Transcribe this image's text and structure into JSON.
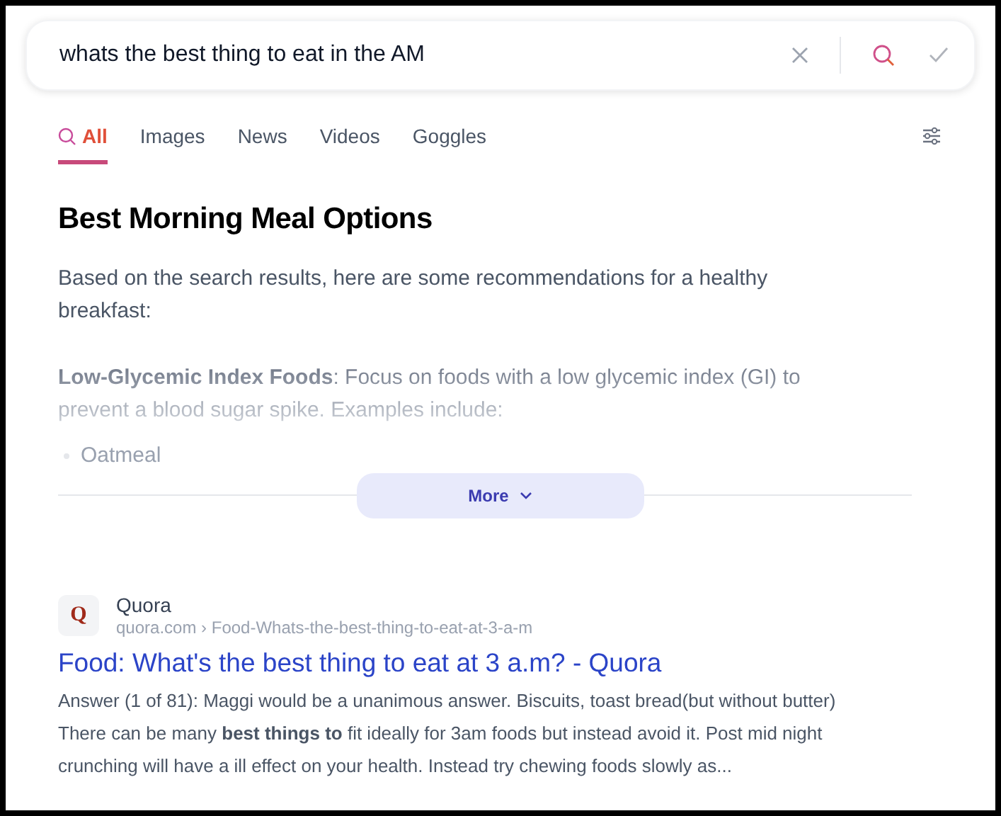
{
  "search": {
    "value": "whats the best thing to eat in the AM"
  },
  "tabs": [
    {
      "label": "All",
      "selected": true
    },
    {
      "label": "Images",
      "selected": false
    },
    {
      "label": "News",
      "selected": false
    },
    {
      "label": "Videos",
      "selected": false
    },
    {
      "label": "Goggles",
      "selected": false
    }
  ],
  "summary": {
    "title": "Best Morning Meal Options",
    "intro": "Based on the search results, here are some recommendations for a healthy breakfast:",
    "point": "**Low-Glycemic Index Foods**: Focus on foods with a low glycemic index (GI) to prevent a blood sugar spike. Examples include:",
    "list": [
      "Oatmeal"
    ],
    "more_button": "More"
  },
  "results": [
    {
      "site": "Quora",
      "favicon": "Q",
      "url": "quora.com › Food-Whats-the-best-thing-to-eat-at-3-a-m",
      "title": "Food: What's the best thing to eat at 3 a.m? - Quora",
      "snippet": "Answer (1 of 81): Maggi would be a unanimous answer. Biscuits, toast bread(but without butter) There can be many **best things to** fit ideally for 3am foods but instead avoid it. Post mid night crunching will have a ill effect on your health. Instead try chewing foods slowly as..."
    }
  ]
}
